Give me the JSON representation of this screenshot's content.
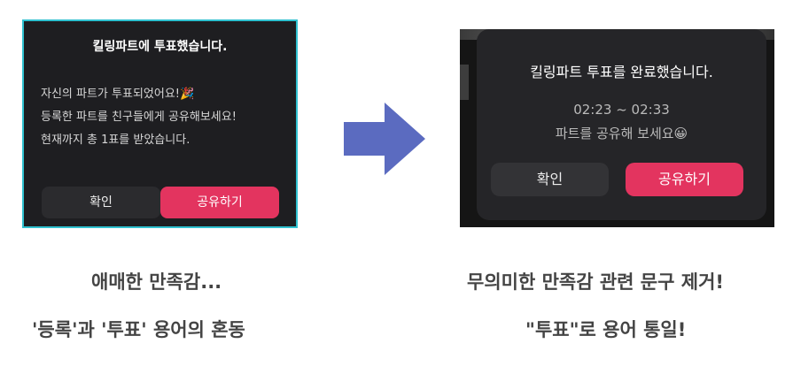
{
  "left_modal": {
    "title": "킬링파트에 투표했습니다.",
    "body_lines": [
      "자신의 파트가 투표되었어요!🎉",
      "등록한 파트를 친구들에게 공유해보세요!",
      "현재까지 총 1표를 받았습니다."
    ],
    "confirm_label": "확인",
    "share_label": "공유하기"
  },
  "right_modal": {
    "title": "킬링파트 투표를 완료했습니다.",
    "time_range": "02:23 ~ 02:33",
    "share_message": "파트를 공유해 보세요😀",
    "confirm_label": "확인",
    "share_label": "공유하기"
  },
  "captions": {
    "left_1": "애매한 만족감...",
    "left_2": "'등록'과 '투표' 용어의 혼동",
    "right_1": "무의미한 만족감 관련 문구 제거!",
    "right_2": "\"투표\"로 용어 통일!"
  },
  "colors": {
    "accent": "#e3345f",
    "arrow": "#5b6bc0",
    "highlight_border": "#2fc1d0"
  },
  "icons": {
    "arrow": "right-arrow-icon"
  }
}
